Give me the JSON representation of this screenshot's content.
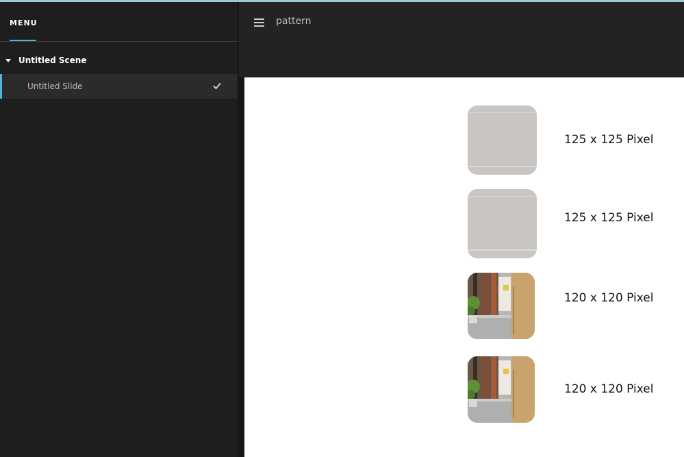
{
  "sidebar": {
    "menu_tab_label": "MENU",
    "scene": {
      "label": "Untitled Scene"
    },
    "slides": [
      {
        "label": "Untitled Slide",
        "selected": true
      }
    ]
  },
  "topbar": {
    "title": "pattern"
  },
  "canvas": {
    "items": [
      {
        "label": "125 x 125 Pixel",
        "thumb": "pattern"
      },
      {
        "label": "125 x 125 Pixel",
        "thumb": "pattern"
      },
      {
        "label": "120 x 120 Pixel",
        "thumb": "photo"
      },
      {
        "label": "120 x 120 Pixel",
        "thumb": "photo"
      }
    ]
  },
  "colors": {
    "accent": "#4fb3e6",
    "sidebar_bg": "#1e1e1e",
    "topbar_bg": "#232323",
    "canvas_bg": "#ffffff"
  }
}
